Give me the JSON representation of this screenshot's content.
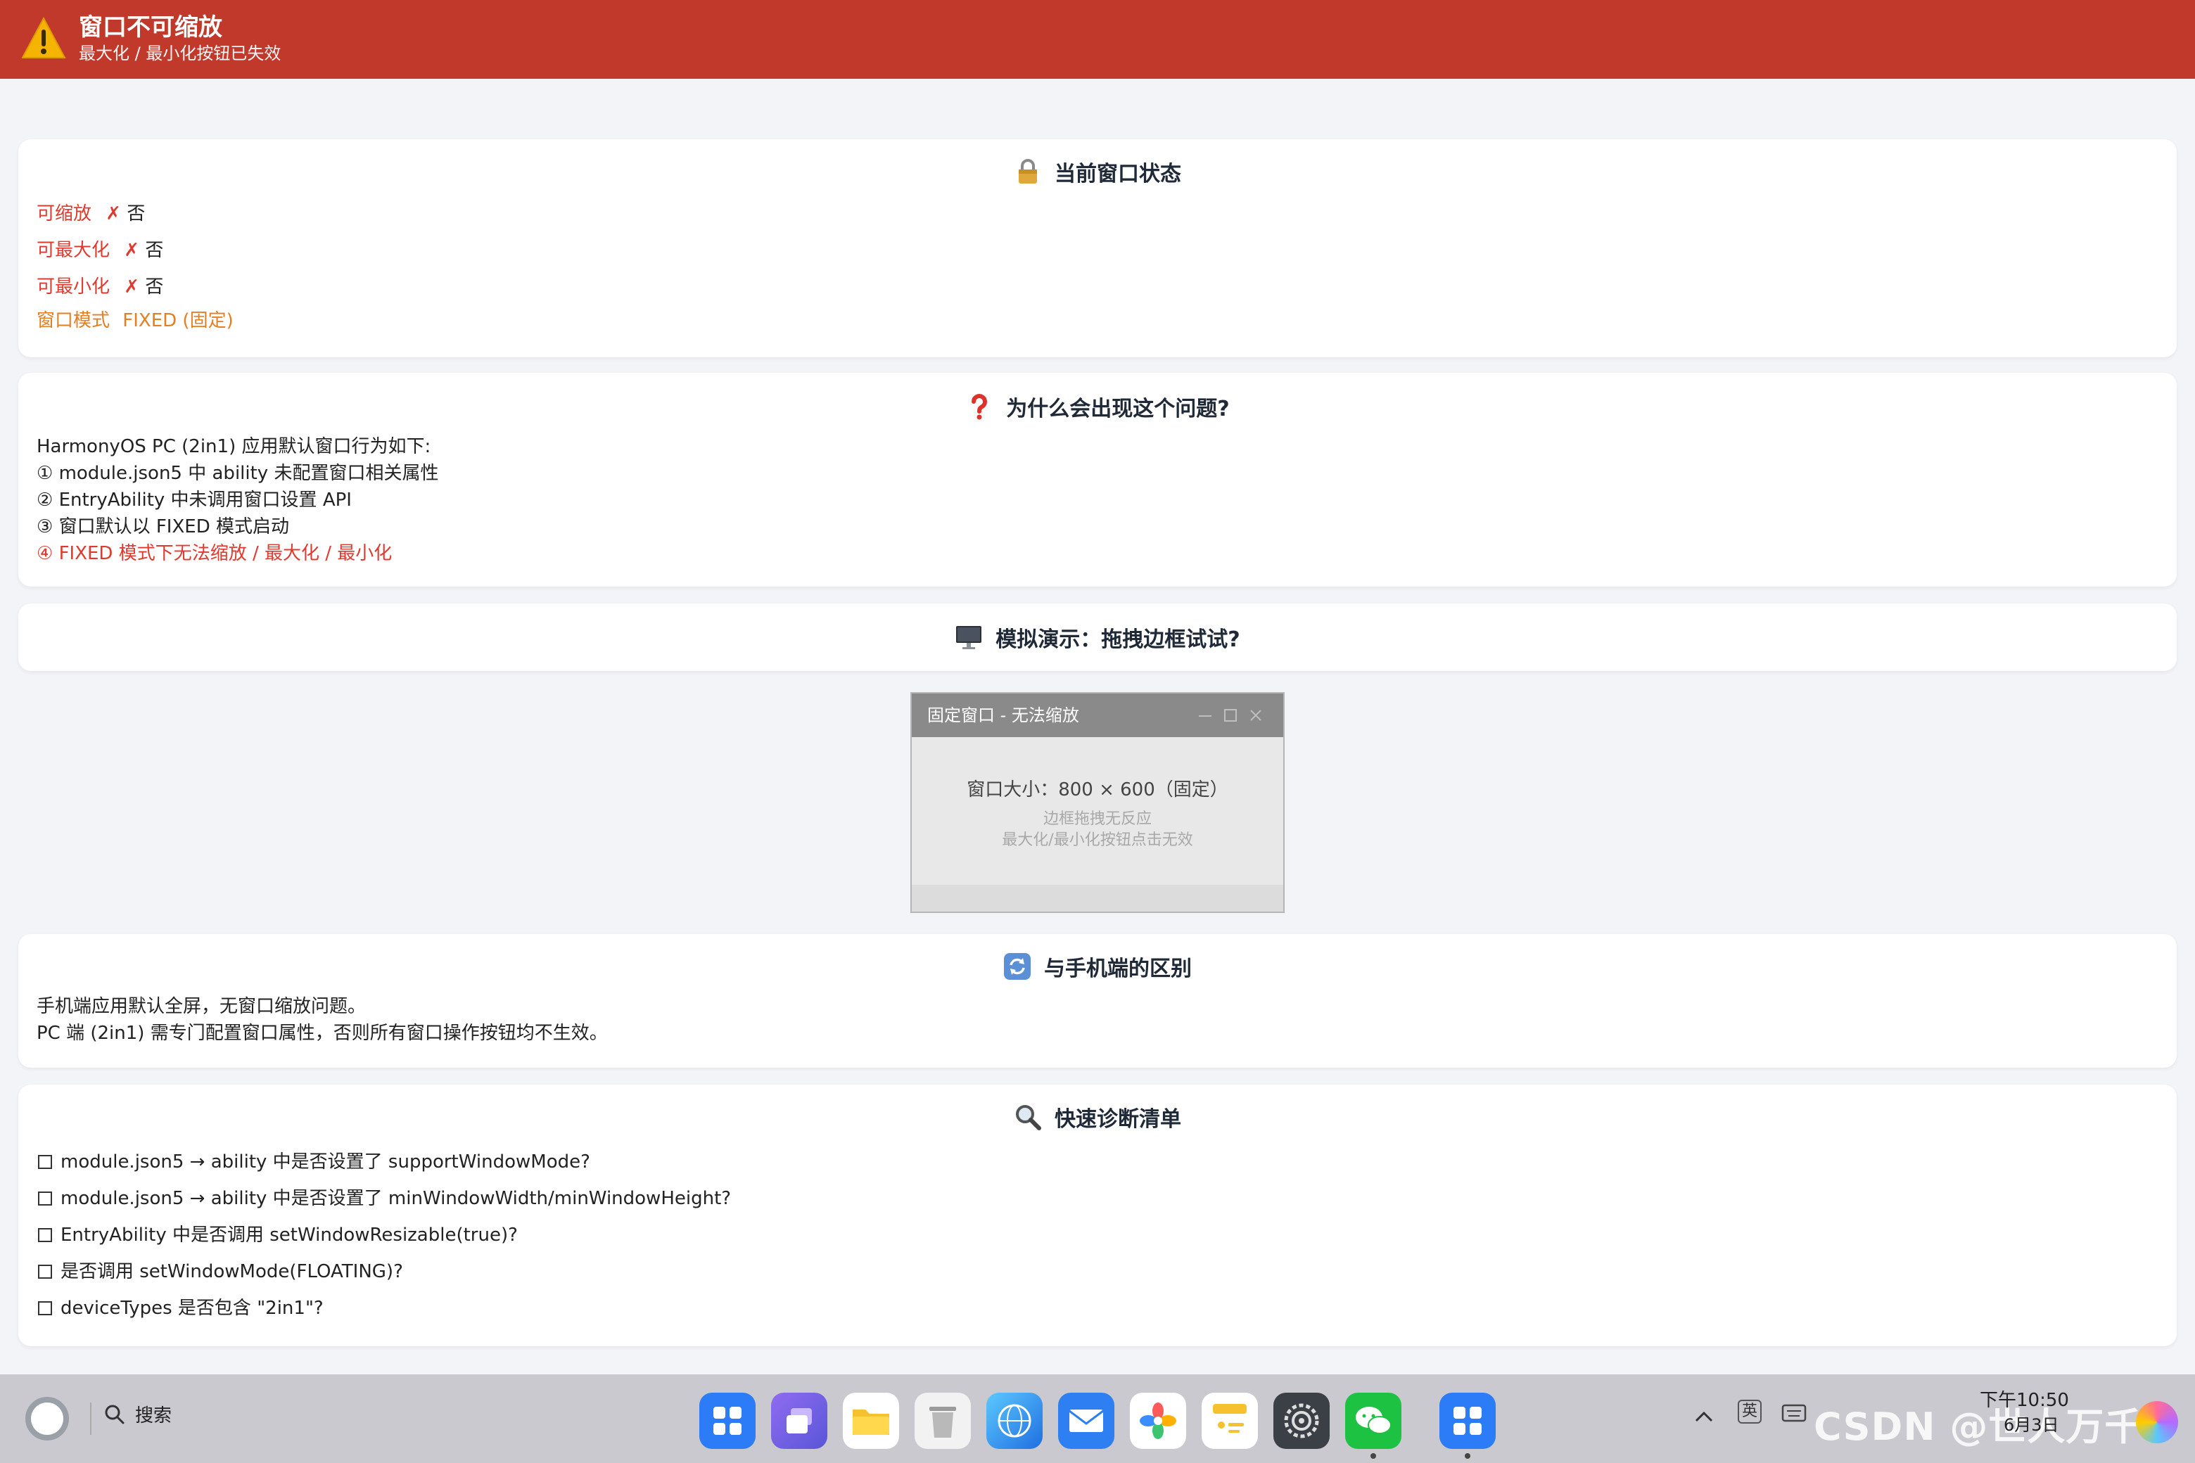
{
  "banner": {
    "title": "窗口不可缩放",
    "subtitle": "最大化 / 最小化按钮已失效",
    "color": "#c0392b"
  },
  "status_card": {
    "title": "当前窗口状态",
    "icon": "lock-icon",
    "rows": [
      {
        "label": "可缩放",
        "mark": "✗",
        "value": "否"
      },
      {
        "label": "可最大化",
        "mark": "✗",
        "value": "否"
      },
      {
        "label": "可最小化",
        "mark": "✗",
        "value": "否"
      }
    ],
    "mode_label": "窗口模式",
    "mode_value": "FIXED (固定)"
  },
  "why_card": {
    "title": "为什么会出现这个问题?",
    "icon": "question-icon",
    "intro": "HarmonyOS PC (2in1) 应用默认窗口行为如下:",
    "items": [
      "① module.json5 中 ability 未配置窗口相关属性",
      "② EntryAbility 中未调用窗口设置 API",
      "③ 窗口默认以 FIXED 模式启动",
      "④ FIXED 模式下无法缩放 / 最大化 / 最小化"
    ]
  },
  "demo_card": {
    "title": "模拟演示：拖拽边框试试?",
    "icon": "monitor-icon",
    "window_title": "固定窗口 - 无法缩放",
    "size_text": "窗口大小：800 × 600（固定）",
    "hint_1": "边框拖拽无反应",
    "hint_2": "最大化/最小化按钮点击无效"
  },
  "diff_card": {
    "title": "与手机端的区别",
    "icon": "refresh-icon",
    "line_1": "手机端应用默认全屏，无窗口缩放问题。",
    "line_2": "PC 端 (2in1) 需专门配置窗口属性，否则所有窗口操作按钮均不生效。"
  },
  "checklist_card": {
    "title": "快速诊断清单",
    "icon": "magnifier-icon",
    "items": [
      "module.json5 → ability 中是否设置了 supportWindowMode?",
      "module.json5 → ability 中是否设置了 minWindowWidth/minWindowHeight?",
      "EntryAbility 中是否调用 setWindowResizable(true)?",
      "是否调用 setWindowMode(FLOATING)?",
      "deviceTypes 是否包含 \"2in1\"?"
    ]
  },
  "taskbar": {
    "search_label": "搜索",
    "dock": [
      "app-center-icon",
      "multitask-icon",
      "files-icon",
      "trash-icon",
      "browser-icon",
      "mail-icon",
      "gallery-icon",
      "notes-icon",
      "settings-icon",
      "wechat-icon",
      "app-grid-icon"
    ],
    "ime_label": "英",
    "time": "下午10:50",
    "date": "6月3日",
    "watermark": "CSDN @世人万千"
  },
  "colors": {
    "accent_red": "#e03a2f",
    "accent_orange": "#e67e22",
    "background": "#f3f4f8"
  }
}
